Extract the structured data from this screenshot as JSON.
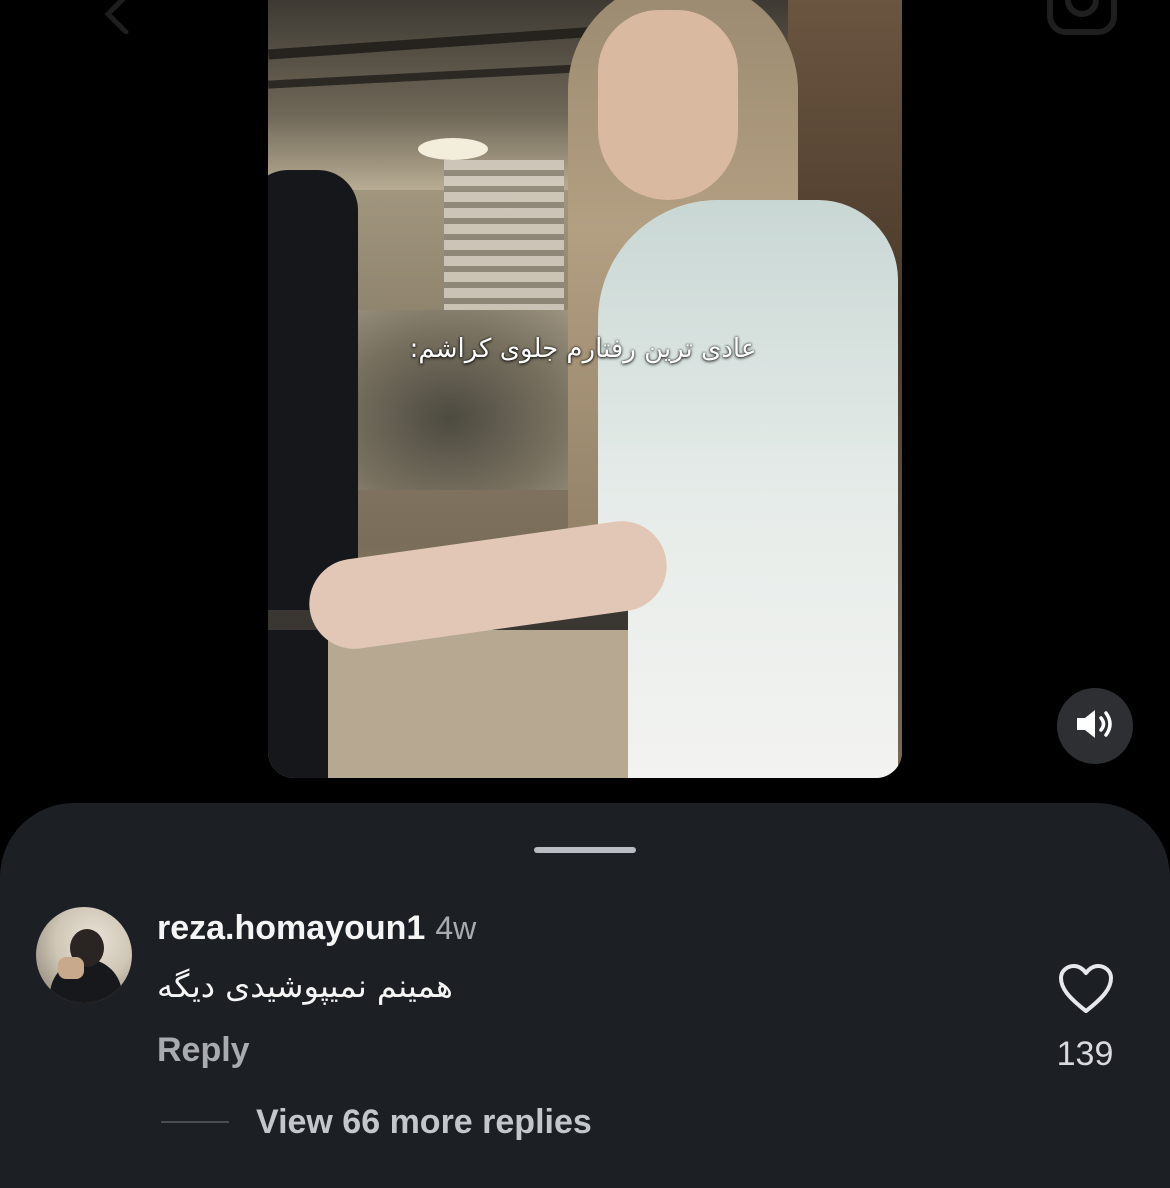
{
  "top_bar": {
    "back_icon": "chevron-left-icon",
    "camera_icon": "camera-icon"
  },
  "video": {
    "caption": "عادی ترین رفتارم جلوی کراشم:",
    "mute_icon": "speaker-icon"
  },
  "comment": {
    "username": "reza.homayoun1",
    "time": "4w",
    "text": "همینم نمیپوشیدی دیگه",
    "reply_label": "Reply",
    "like_icon": "heart-icon",
    "like_count": "139",
    "view_replies": "View 66 more replies"
  },
  "colors": {
    "background": "#000000",
    "sheet": "#1c1f24",
    "primary_text": "#f5f5f5",
    "secondary_text": "#a8abb0"
  }
}
